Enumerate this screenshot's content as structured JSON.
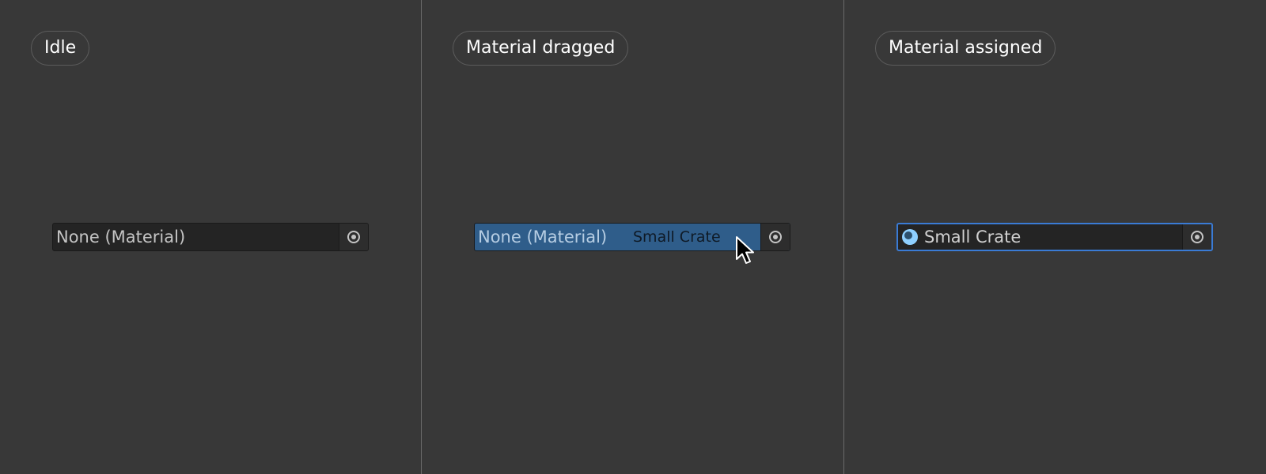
{
  "panels": [
    {
      "state_label": "Idle",
      "field_value": "None (Material)"
    },
    {
      "state_label": "Material dragged",
      "field_value": "None (Material)",
      "drag_item": "Small Crate"
    },
    {
      "state_label": "Material assigned",
      "field_value": "Small Crate",
      "material_icon": "material-sphere-icon"
    }
  ],
  "icons": {
    "picker": "object-picker-icon",
    "cursor": "mouse-pointer-icon"
  },
  "colors": {
    "background": "#383838",
    "field_background": "#242424",
    "drag_highlight": "#2f5d8a",
    "assigned_border": "#3a7bd5",
    "material_icon": "#8fd0ff"
  }
}
